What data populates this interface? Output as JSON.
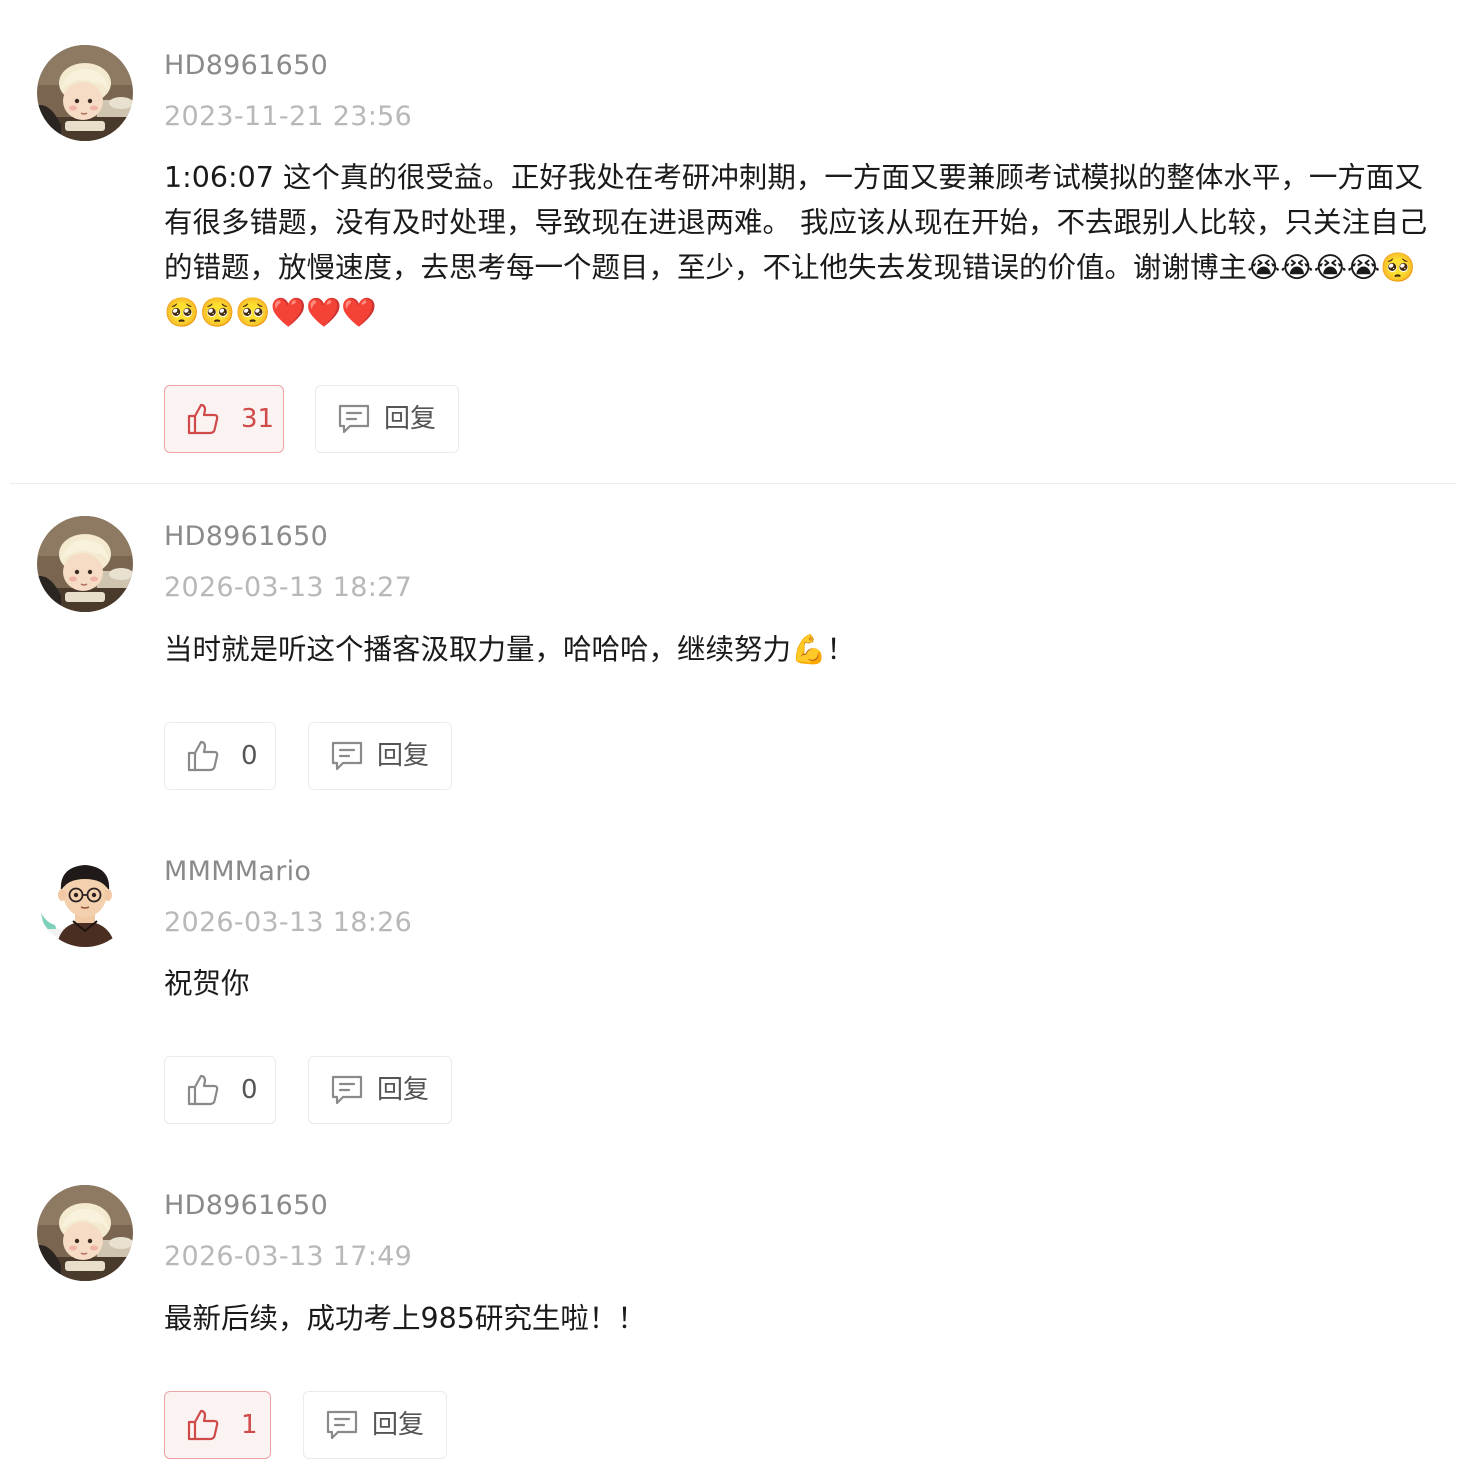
{
  "colors": {
    "accent": "#d04a4a",
    "liked_border": "#eaa4a4",
    "liked_bg": "#fbf2f2",
    "username": "#8a8a8a",
    "timestamp": "#b8b8b8"
  },
  "reply_label": "回复",
  "comments": [
    {
      "username": "HD8961650",
      "timestamp": "2023-11-21 23:56",
      "content": "1:06:07 这个真的很受益。正好我处在考研冲刺期，一方面又要兼顾考试模拟的整体水平，一方面又有很多错题，没有及时处理，导致现在进退两难。 我应该从现在开始，不去跟别人比较，只关注自己的错题，放慢速度，去思考每一个题目，至少，不让他失去发现错误的价值。谢谢博主😭😭😭😭🥺🥺🥺🥺❤️❤️❤️",
      "likes": "31",
      "liked": true,
      "avatar": "girl-avatar"
    },
    {
      "username": "HD8961650",
      "timestamp": "2026-03-13 18:27",
      "content": "当时就是听这个播客汲取力量，哈哈哈，继续努力💪！",
      "likes": "0",
      "liked": false,
      "avatar": "girl-avatar"
    },
    {
      "username": "MMMMario",
      "timestamp": "2026-03-13 18:26",
      "content": "祝贺你",
      "likes": "0",
      "liked": false,
      "avatar": "boy-avatar"
    },
    {
      "username": "HD8961650",
      "timestamp": "2026-03-13 17:49",
      "content": "最新后续，成功考上985研究生啦！！",
      "likes": "1",
      "liked": true,
      "avatar": "girl-avatar"
    }
  ]
}
